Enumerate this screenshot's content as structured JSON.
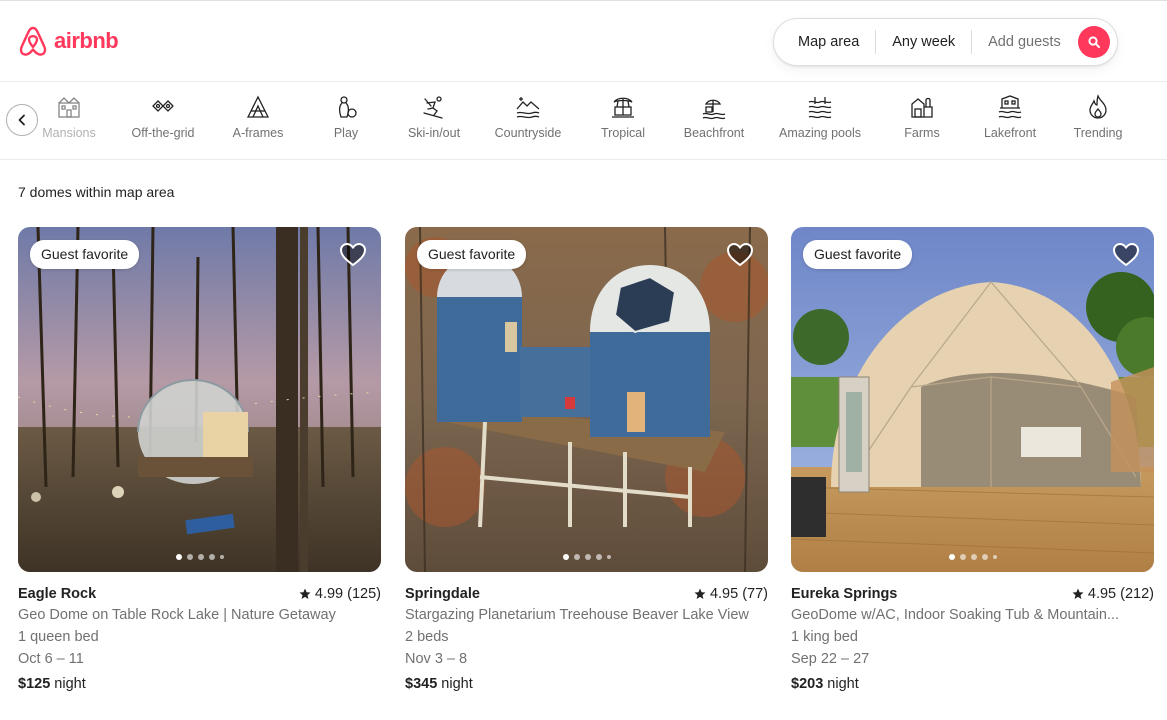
{
  "brand": {
    "name": "airbnb",
    "color": "#ff385c"
  },
  "search": {
    "where": "Map area",
    "when": "Any week",
    "who": "Add guests"
  },
  "categories": [
    {
      "label": "Mansions",
      "icon": "mansion-icon"
    },
    {
      "label": "Off-the-grid",
      "icon": "off-grid-icon"
    },
    {
      "label": "A-frames",
      "icon": "a-frame-icon"
    },
    {
      "label": "Play",
      "icon": "play-icon"
    },
    {
      "label": "Ski-in/out",
      "icon": "skier-icon"
    },
    {
      "label": "Countryside",
      "icon": "countryside-icon"
    },
    {
      "label": "Tropical",
      "icon": "palm-tree-icon"
    },
    {
      "label": "Beachfront",
      "icon": "beachfront-icon"
    },
    {
      "label": "Amazing pools",
      "icon": "pool-icon"
    },
    {
      "label": "Farms",
      "icon": "farm-icon"
    },
    {
      "label": "Lakefront",
      "icon": "lakefront-icon"
    },
    {
      "label": "Trending",
      "icon": "flame-icon"
    }
  ],
  "results": {
    "count_text": "7 domes within map area"
  },
  "listings": [
    {
      "badge": "Guest favorite",
      "city": "Eagle Rock",
      "rating": "4.99 (125)",
      "title": "Geo Dome on Table Rock Lake | Nature Getaway",
      "beds": "1 queen bed",
      "dates": "Oct 6 – 11",
      "price": "$125",
      "price_unit": "night",
      "photo": "photo-forest-dome"
    },
    {
      "badge": "Guest favorite",
      "city": "Springdale",
      "rating": "4.95 (77)",
      "title": "Stargazing Planetarium Treehouse Beaver Lake View",
      "beds": "2 beds",
      "dates": "Nov 3 – 8",
      "price": "$345",
      "price_unit": "night",
      "photo": "photo-blue-treehouse"
    },
    {
      "badge": "Guest favorite",
      "city": "Eureka Springs",
      "rating": "4.95 (212)",
      "title": "GeoDome w/AC, Indoor Soaking Tub & Mountain...",
      "beds": "1 king bed",
      "dates": "Sep 22 – 27",
      "price": "$203",
      "price_unit": "night",
      "photo": "photo-canvas-dome"
    }
  ]
}
